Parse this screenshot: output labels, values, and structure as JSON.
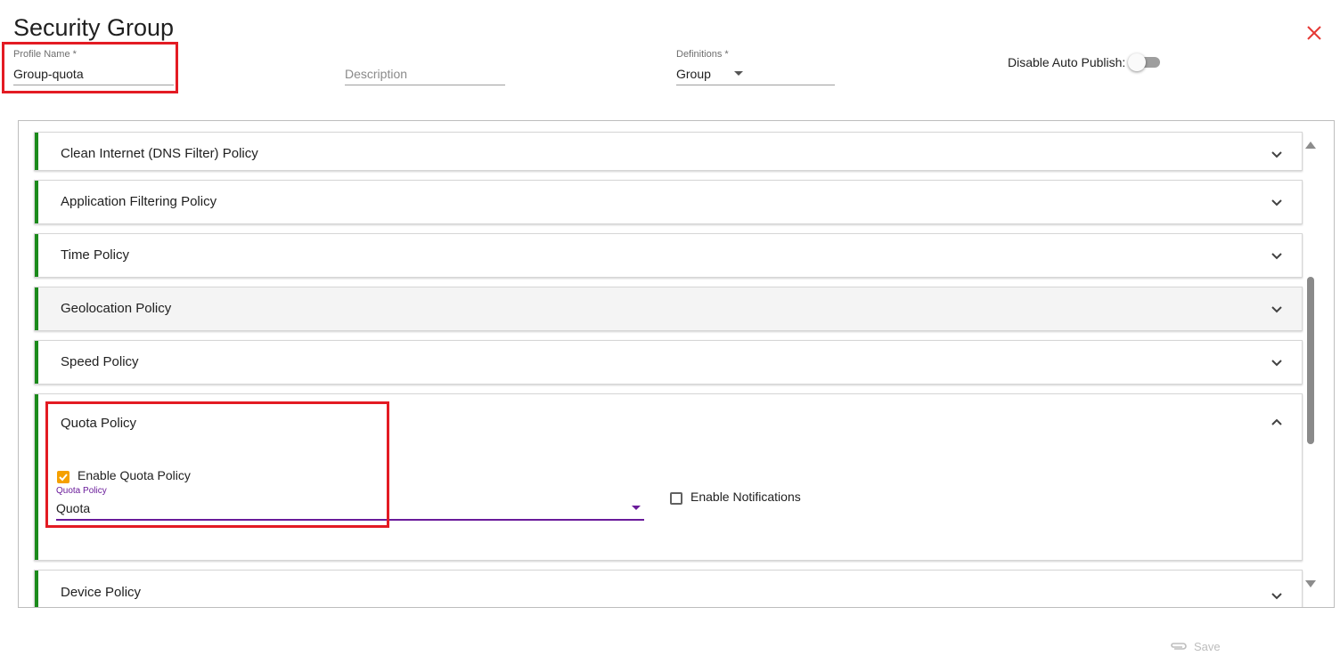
{
  "dialog": {
    "title": "Security Group",
    "close_icon": "close-icon",
    "close_color": "#e53935"
  },
  "form": {
    "profile_name": {
      "label": "Profile Name *",
      "value": "Group-quota"
    },
    "description": {
      "placeholder": "Description",
      "value": ""
    },
    "definitions": {
      "label": "Definitions *",
      "value": "Group"
    },
    "auto_publish": {
      "label": "Disable Auto Publish:",
      "enabled": false
    }
  },
  "policies": [
    {
      "label": "Clean Internet (DNS Filter) Policy",
      "expanded": false
    },
    {
      "label": "Application Filtering Policy",
      "expanded": false
    },
    {
      "label": "Time Policy",
      "expanded": false
    },
    {
      "label": "Geolocation Policy",
      "expanded": false
    },
    {
      "label": "Speed Policy",
      "expanded": false
    },
    {
      "label": "Quota Policy",
      "expanded": true
    },
    {
      "label": "Device Policy",
      "expanded": false
    }
  ],
  "quota_policy": {
    "enable_label": "Enable Quota Policy",
    "enable_checked": true,
    "select_label": "Quota Policy",
    "select_value": "Quota",
    "notifications_label": "Enable Notifications",
    "notifications_checked": false
  },
  "footer": {
    "save_label": "Save",
    "save_icon": "paperclip-icon"
  },
  "colors": {
    "accent_bar": "#1b8a1b",
    "checkbox": "#f5a000",
    "select_accent": "#6a1b9a",
    "highlight": "#e31b23"
  }
}
